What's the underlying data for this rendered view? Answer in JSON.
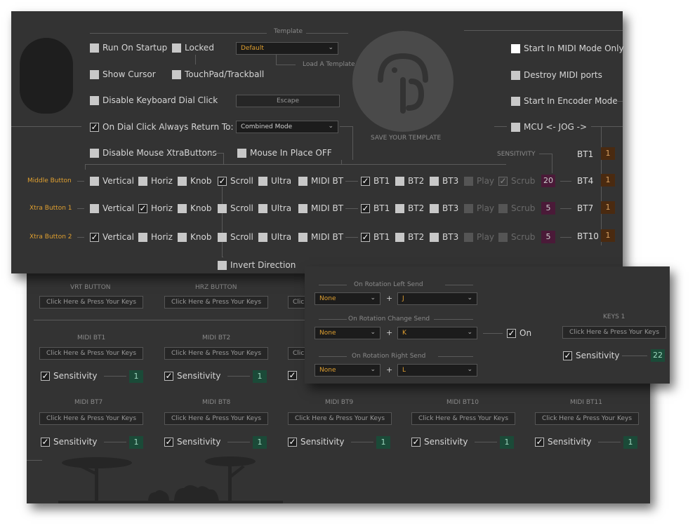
{
  "top": {
    "template_label": "Template",
    "template_value": "Default",
    "load_template": "Load A Template",
    "save_template": "SAVE YOUR TEMPLATE",
    "run_on_startup": "Run On Startup",
    "locked": "Locked",
    "show_cursor": "Show Cursor",
    "touchpad": "TouchPad/Trackball",
    "disable_dial_click": "Disable Keyboard Dial Click",
    "escape_field": "Escape",
    "on_dial_click": "On Dial Click Always Return To:",
    "combined_mode": "Combined Mode",
    "disable_mouse_xtra": "Disable Mouse XtraButtons",
    "mouse_in_place": "Mouse In Place OFF",
    "start_midi_mode": "Start In MIDI Mode Only",
    "destroy_midi": "Destroy MIDI ports",
    "start_encoder": "Start In Encoder Mode",
    "mcu_jog": "MCU <- JOG ->",
    "sensitivity_label": "SENSITIVITY",
    "invert_direction": "Invert Direction",
    "rows": [
      {
        "label": "Middle Button",
        "sens": "20"
      },
      {
        "label": "Xtra Button 1",
        "sens": "5"
      },
      {
        "label": "Xtra Button 2",
        "sens": "5"
      }
    ],
    "opts": {
      "vertical": "Vertical",
      "horiz": "Horiz",
      "knob": "Knob",
      "scroll": "Scroll",
      "ultra": "Ultra",
      "midibt": "MIDI BT",
      "bt1": "BT1",
      "bt2": "BT2",
      "bt3": "BT3",
      "play": "Play",
      "scrub": "Scrub"
    },
    "bt_col": [
      {
        "label": "BT1",
        "value": "1"
      },
      {
        "label": "BT4",
        "value": "1"
      },
      {
        "label": "BT7",
        "value": "1"
      },
      {
        "label": "BT10",
        "value": "1"
      }
    ]
  },
  "bottom": {
    "vrt": "VRT BUTTON",
    "hrz": "HRZ BUTTON",
    "click_here": "Click Here & Press Your Keys",
    "click_here_short": "Clic",
    "sensitivity": "Sensitivity",
    "midi_bt1": "MIDI BT1",
    "midi_bt2": "MIDI BT2",
    "midi_bt7": "MIDI BT7",
    "midi_bt8": "MIDI BT8",
    "midi_bt9": "MIDI BT9",
    "midi_bt10": "MIDI BT10",
    "midi_bt11": "MIDI BT11",
    "one": "1"
  },
  "rotation": {
    "left_send": "On Rotation Left Send",
    "change_send": "On Rotation Change Send",
    "right_send": "On Rotation Right Send",
    "none": "None",
    "plus": "+",
    "key_j": "J",
    "key_k": "K",
    "key_l": "L",
    "on": "On",
    "keys1": "KEYS 1",
    "click_here": "Click Here & Press Your Keys",
    "sensitivity": "Sensitivity",
    "sens_value": "22"
  },
  "colors": {
    "accent_orange": "#e0a030",
    "panel": "#333333",
    "purple": "#4a1a38",
    "brown": "#4a2a10",
    "green": "#1b4a38"
  }
}
